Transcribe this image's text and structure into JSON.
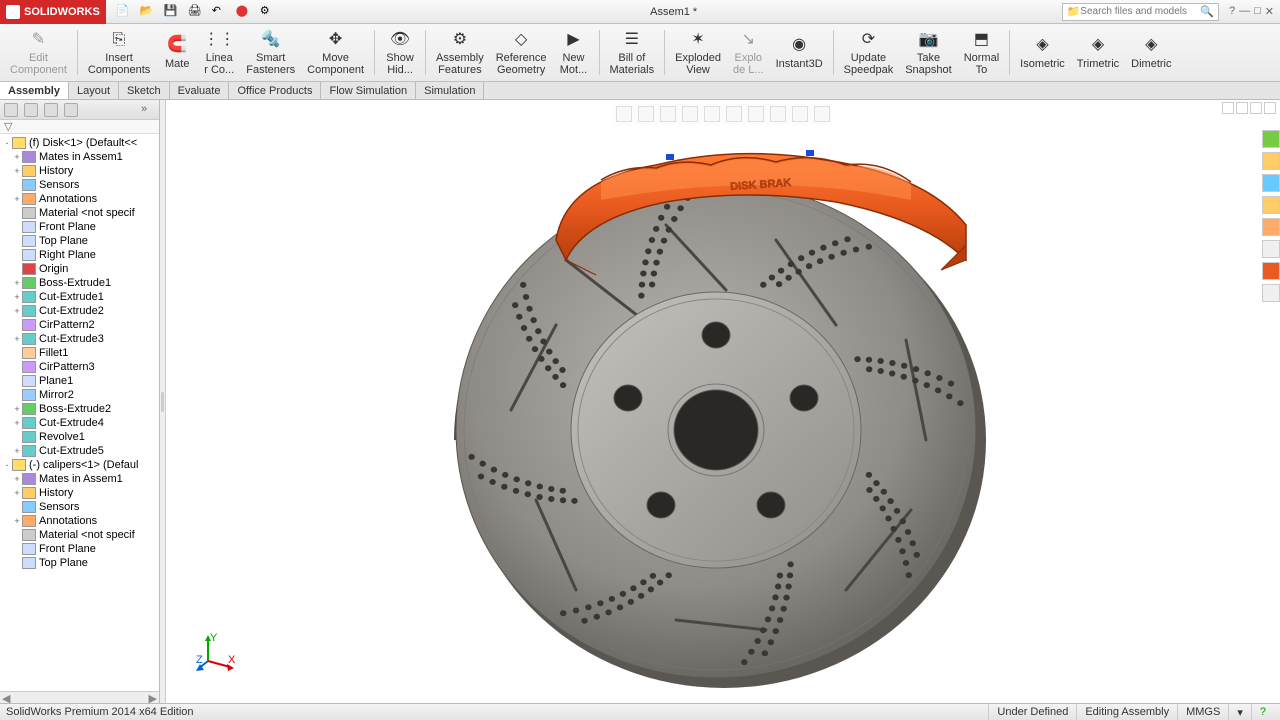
{
  "app": {
    "name": "SOLIDWORKS",
    "document": "Assem1 *",
    "search_placeholder": "Search files and models",
    "edition": "SolidWorks Premium 2014 x64 Edition"
  },
  "ribbon": [
    {
      "id": "edit-component",
      "label": "Edit\nComponent",
      "disabled": true
    },
    {
      "id": "insert-components",
      "label": "Insert\nComponents"
    },
    {
      "id": "mate",
      "label": "Mate"
    },
    {
      "id": "linear-co",
      "label": "Linea\nr Co..."
    },
    {
      "id": "smart-fasteners",
      "label": "Smart\nFasteners"
    },
    {
      "id": "move-component",
      "label": "Move\nComponent"
    },
    {
      "id": "show-hidden",
      "label": "Show\nHid..."
    },
    {
      "id": "assembly-features",
      "label": "Assembly\nFeatures"
    },
    {
      "id": "reference-geometry",
      "label": "Reference\nGeometry"
    },
    {
      "id": "new-motion",
      "label": "New\nMot..."
    },
    {
      "id": "bill-of-materials",
      "label": "Bill of\nMaterials"
    },
    {
      "id": "exploded-view",
      "label": "Exploded\nView"
    },
    {
      "id": "explode-line",
      "label": "Explo\nde L...",
      "disabled": true
    },
    {
      "id": "instant3d",
      "label": "Instant3D"
    },
    {
      "id": "update-speedpak",
      "label": "Update\nSpeedpak"
    },
    {
      "id": "take-snapshot",
      "label": "Take\nSnapshot"
    },
    {
      "id": "normal-to",
      "label": "Normal\nTo"
    },
    {
      "id": "isometric",
      "label": "Isometric"
    },
    {
      "id": "trimetric",
      "label": "Trimetric"
    },
    {
      "id": "dimetric",
      "label": "Dimetric"
    }
  ],
  "cmd_tabs": [
    "Assembly",
    "Layout",
    "Sketch",
    "Evaluate",
    "Office Products",
    "Flow Simulation",
    "Simulation"
  ],
  "cmd_active": 0,
  "tree": [
    {
      "t": "(f) Disk<1> (Default<<",
      "lvl": 0,
      "exp": "-"
    },
    {
      "t": "Mates in Assem1",
      "lvl": 1,
      "exp": "+"
    },
    {
      "t": "History",
      "lvl": 1,
      "exp": "+"
    },
    {
      "t": "Sensors",
      "lvl": 1
    },
    {
      "t": "Annotations",
      "lvl": 1,
      "exp": "+"
    },
    {
      "t": "Material <not specif",
      "lvl": 1
    },
    {
      "t": "Front Plane",
      "lvl": 1
    },
    {
      "t": "Top Plane",
      "lvl": 1
    },
    {
      "t": "Right Plane",
      "lvl": 1
    },
    {
      "t": "Origin",
      "lvl": 1
    },
    {
      "t": "Boss-Extrude1",
      "lvl": 1,
      "exp": "+"
    },
    {
      "t": "Cut-Extrude1",
      "lvl": 1,
      "exp": "+"
    },
    {
      "t": "Cut-Extrude2",
      "lvl": 1,
      "exp": "+"
    },
    {
      "t": "CirPattern2",
      "lvl": 1
    },
    {
      "t": "Cut-Extrude3",
      "lvl": 1,
      "exp": "+"
    },
    {
      "t": "Fillet1",
      "lvl": 1
    },
    {
      "t": "CirPattern3",
      "lvl": 1
    },
    {
      "t": "Plane1",
      "lvl": 1
    },
    {
      "t": "Mirror2",
      "lvl": 1
    },
    {
      "t": "Boss-Extrude2",
      "lvl": 1,
      "exp": "+"
    },
    {
      "t": "Cut-Extrude4",
      "lvl": 1,
      "exp": "+"
    },
    {
      "t": "Revolve1",
      "lvl": 1
    },
    {
      "t": "Cut-Extrude5",
      "lvl": 1,
      "exp": "+"
    },
    {
      "t": "(-) calipers<1> (Defaul",
      "lvl": 0,
      "exp": "-"
    },
    {
      "t": "Mates in Assem1",
      "lvl": 1,
      "exp": "+"
    },
    {
      "t": "History",
      "lvl": 1,
      "exp": "+"
    },
    {
      "t": "Sensors",
      "lvl": 1
    },
    {
      "t": "Annotations",
      "lvl": 1,
      "exp": "+"
    },
    {
      "t": "Material <not specif",
      "lvl": 1
    },
    {
      "t": "Front Plane",
      "lvl": 1
    },
    {
      "t": "Top Plane",
      "lvl": 1
    }
  ],
  "status": {
    "state": "Under Defined",
    "mode": "Editing Assembly",
    "units": "MMGS"
  },
  "model": {
    "caliper_text": "DISK BRAK",
    "colors": {
      "rotor": "#8f8c88",
      "rotor_edge": "#5a5753",
      "hub": "#a9a6a2",
      "caliper": "#e85a1f",
      "caliper_dark": "#b83d0a"
    }
  },
  "triad": {
    "x": "X",
    "y": "Y",
    "z": "Z"
  }
}
